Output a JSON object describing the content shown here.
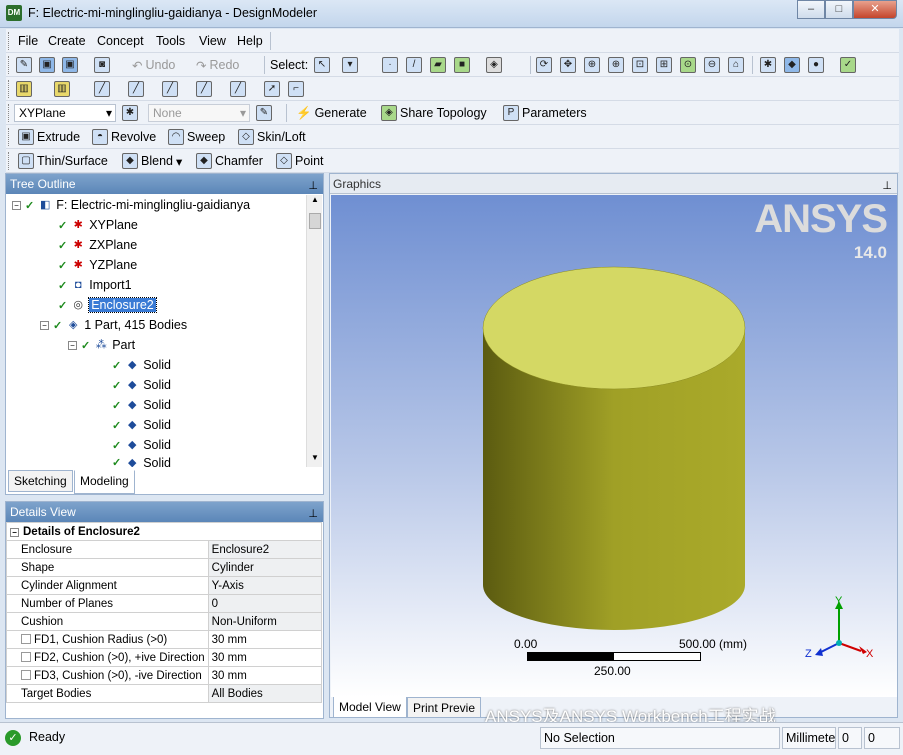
{
  "window": {
    "title": "F: Electric-mi-minglingliu-gaidianya - DesignModeler",
    "app_icon": "DM",
    "minimize": "–",
    "maximize": "□",
    "close": "✕"
  },
  "menu": [
    "File",
    "Create",
    "Concept",
    "Tools",
    "View",
    "Help"
  ],
  "toolbar1": {
    "undo": "Undo",
    "redo": "Redo",
    "select": "Select:"
  },
  "toolbar3": {
    "plane": "XYPlane",
    "sketch": "None",
    "generate": "Generate",
    "share_topology": "Share Topology",
    "parameters": "Parameters"
  },
  "toolbar4": {
    "extrude": "Extrude",
    "revolve": "Revolve",
    "sweep": "Sweep",
    "skinloft": "Skin/Loft"
  },
  "toolbar5": {
    "thinsurface": "Thin/Surface",
    "blend": "Blend",
    "chamfer": "Chamfer",
    "point": "Point"
  },
  "tree_outline": {
    "title": "Tree Outline",
    "items": [
      {
        "label": "F: Electric-mi-minglingliu-gaidianya",
        "icon": "model-icon"
      },
      {
        "label": "XYPlane",
        "icon": "plane-axis-icon"
      },
      {
        "label": "ZXPlane",
        "icon": "plane-axis-icon"
      },
      {
        "label": "YZPlane",
        "icon": "plane-axis-icon"
      },
      {
        "label": "Import1",
        "icon": "import-icon"
      },
      {
        "label": "Enclosure2",
        "icon": "enclosure-icon"
      },
      {
        "label": "1 Part, 415 Bodies",
        "icon": "bodies-icon"
      },
      {
        "label": "Part",
        "icon": "part-icon"
      },
      {
        "label": "Solid",
        "icon": "solid-icon"
      },
      {
        "label": "Solid",
        "icon": "solid-icon"
      },
      {
        "label": "Solid",
        "icon": "solid-icon"
      },
      {
        "label": "Solid",
        "icon": "solid-icon"
      },
      {
        "label": "Solid",
        "icon": "solid-icon"
      },
      {
        "label": "Solid",
        "icon": "solid-icon"
      }
    ],
    "tabs": [
      "Sketching",
      "Modeling"
    ]
  },
  "details_view": {
    "title": "Details View",
    "header": "Details of Enclosure2",
    "rows": [
      {
        "label": "Enclosure",
        "value": "Enclosure2",
        "checkbox": false
      },
      {
        "label": "Shape",
        "value": "Cylinder",
        "checkbox": false
      },
      {
        "label": "Cylinder Alignment",
        "value": "Y-Axis",
        "checkbox": false
      },
      {
        "label": "Number of Planes",
        "value": "0",
        "checkbox": false
      },
      {
        "label": "Cushion",
        "value": "Non-Uniform",
        "checkbox": false
      },
      {
        "label": "FD1, Cushion Radius (>0)",
        "value": "30 mm",
        "checkbox": true
      },
      {
        "label": "FD2, Cushion (>0), +ive Direction",
        "value": "30 mm",
        "checkbox": true
      },
      {
        "label": "FD3, Cushion (>0), -ive Direction",
        "value": "30 mm",
        "checkbox": true
      },
      {
        "label": "Target Bodies",
        "value": "All Bodies",
        "checkbox": false
      }
    ]
  },
  "graphics": {
    "title": "Graphics",
    "logo": "ANSYS",
    "version": "14.0",
    "scale": {
      "left": "0.00",
      "right": "500.00 (mm)",
      "mid": "250.00"
    },
    "axes": {
      "x": "X",
      "y": "Y",
      "z": "Z"
    },
    "tabs": [
      "Model View",
      "Print Previe"
    ],
    "watermark": "ANSYS及ANSYS Workbench工程实战",
    "cylinder_color": "#9a9a1c",
    "top_color": "#d4d864"
  },
  "status": {
    "ready": "Ready",
    "selection": "No Selection",
    "units": "Millimete",
    "v1": "0",
    "v2": "0"
  }
}
